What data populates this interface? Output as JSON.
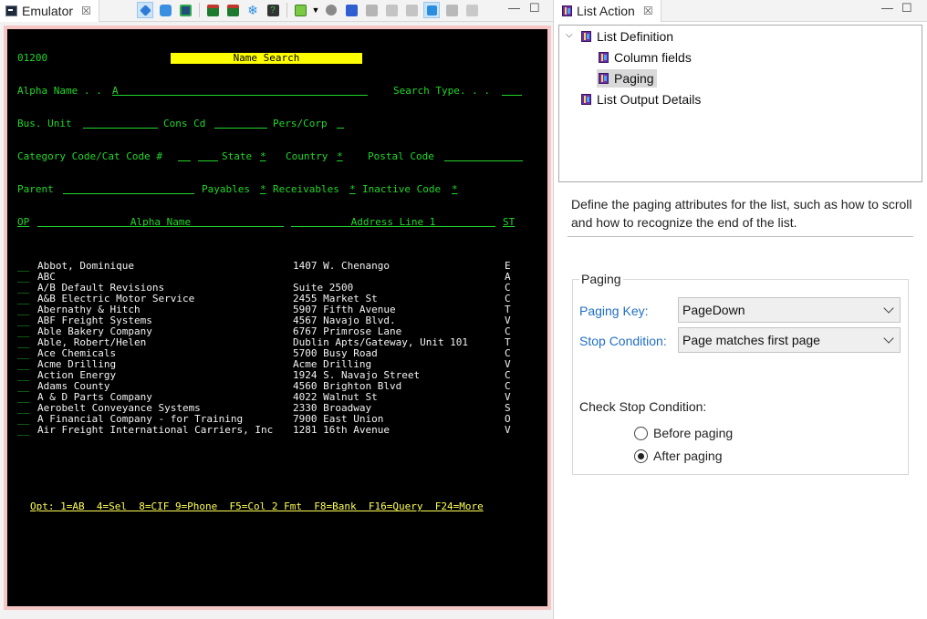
{
  "emulator": {
    "tab_label": "Emulator",
    "tab_close": "☒",
    "win_minimize": "—",
    "win_maximize": "☐",
    "screen": {
      "program_id": "01200",
      "title": "Name Search",
      "alpha_name_label": "Alpha Name . .",
      "alpha_name_value": "A",
      "search_type_label": "Search Type. . .",
      "bus_unit_label": "Bus. Unit",
      "cons_cd_label": "Cons Cd",
      "pers_corp_label": "Pers/Corp",
      "category_label": "Category Code/Cat Code #",
      "state_label": "State",
      "state_value": "*",
      "country_label": "Country",
      "country_value": "*",
      "postal_label": "Postal Code",
      "parent_label": "Parent",
      "payables_label": "Payables",
      "payables_value": "*",
      "receivables_label": "Receivables",
      "receivables_value": "*",
      "inactive_label": "Inactive Code",
      "inactive_value": "*",
      "col_op": "OP",
      "col_alpha_name": "Alpha Name",
      "col_address": "Address Line 1",
      "col_st": "ST",
      "rows": [
        {
          "op": "__",
          "name": "Abbot, Dominique",
          "address": "1407 W. Chenango",
          "st": "E"
        },
        {
          "op": "__",
          "name": "ABC",
          "address": "",
          "st": "A"
        },
        {
          "op": "__",
          "name": "A/B Default Revisions",
          "address": "Suite 2500",
          "st": "C"
        },
        {
          "op": "__",
          "name": "A&B Electric Motor Service",
          "address": "2455 Market St",
          "st": "C"
        },
        {
          "op": "__",
          "name": "Abernathy & Hitch",
          "address": "5907 Fifth Avenue",
          "st": "T"
        },
        {
          "op": "__",
          "name": "ABF Freight Systems",
          "address": "4567 Navajo Blvd.",
          "st": "V"
        },
        {
          "op": "__",
          "name": "Able Bakery Company",
          "address": "6767 Primrose Lane",
          "st": "C"
        },
        {
          "op": "__",
          "name": "Able, Robert/Helen",
          "address": "Dublin Apts/Gateway, Unit 101",
          "st": "T"
        },
        {
          "op": "__",
          "name": "Ace Chemicals",
          "address": "5700 Busy Road",
          "st": "C"
        },
        {
          "op": "__",
          "name": "Acme Drilling",
          "address": "Acme Drilling",
          "st": "V"
        },
        {
          "op": "__",
          "name": "Action Energy",
          "address": "1924 S. Navajo Street",
          "st": "C"
        },
        {
          "op": "__",
          "name": "Adams County",
          "address": "4560 Brighton Blvd",
          "st": "C"
        },
        {
          "op": "__",
          "name": "A & D Parts Company",
          "address": "4022 Walnut St",
          "st": "V"
        },
        {
          "op": "__",
          "name": "Aerobelt Conveyance Systems",
          "address": "2330 Broadway",
          "st": "S"
        },
        {
          "op": "__",
          "name": "A Financial Company - for Training",
          "address": "7900 East Union",
          "st": "O"
        },
        {
          "op": "__",
          "name": "Air Freight International Carriers, Inc",
          "address": "1281 16th Avenue",
          "st": "V"
        }
      ],
      "options_line": "Opt: 1=AB  4=Sel  8=CIF 9=Phone  F5=Col 2 Fmt  F8=Bank  F16=Query  F24=More"
    }
  },
  "list_action": {
    "tab_label": "List Action",
    "tab_close": "☒",
    "win_minimize": "—",
    "win_maximize": "☐",
    "tree": {
      "root": "List Definition",
      "children": [
        "Column fields",
        "Paging"
      ],
      "sibling": "List Output Details",
      "selected": "Paging"
    },
    "description": "Define the paging attributes for the list, such as how to scroll and how to recognize the end of the list.",
    "paging": {
      "group_title": "Paging",
      "paging_key_label": "Paging Key:",
      "paging_key_value": "PageDown",
      "stop_condition_label": "Stop Condition:",
      "stop_condition_value": "Page matches first page",
      "check_stop_label": "Check Stop Condition:",
      "radio_before": "Before paging",
      "radio_after": "After paging",
      "selected_radio": "After paging"
    }
  }
}
